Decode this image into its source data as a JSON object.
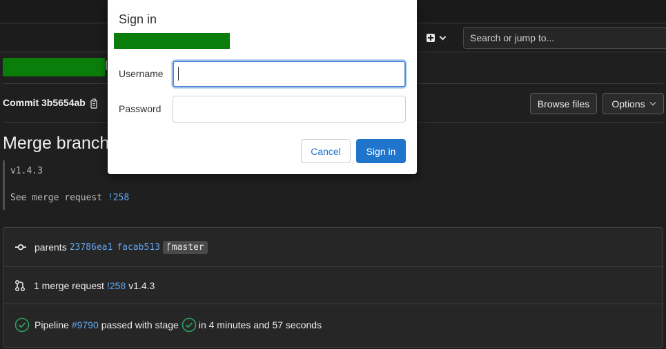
{
  "header": {
    "search_placeholder": "Search or jump to..."
  },
  "commit": {
    "label": "Commit 3b5654ab",
    "browse_label": "Browse files",
    "options_label": "Options",
    "title": "Merge branch",
    "message_version": "v1.4.3",
    "message_see": "See merge request",
    "message_mr_link": "!258"
  },
  "info": {
    "parents_label": "parents",
    "parent_1": "23786ea1",
    "parent_2": "facab513",
    "branch": "master",
    "mr_text": "1 merge request",
    "mr_link": "!258",
    "mr_version": "v1.4.3",
    "pipeline_label": "Pipeline",
    "pipeline_link": "#9790",
    "pipeline_passed": "passed with stage",
    "pipeline_duration": "in 4 minutes and 57 seconds"
  },
  "modal": {
    "title": "Sign in",
    "username_label": "Username",
    "username_value": "",
    "password_label": "Password",
    "password_value": "",
    "cancel_label": "Cancel",
    "signin_label": "Sign in"
  },
  "colors": {
    "redaction": "#0a7d0a",
    "link": "#63a6f0",
    "primary_button": "#1f75cb",
    "success": "#2da160"
  }
}
